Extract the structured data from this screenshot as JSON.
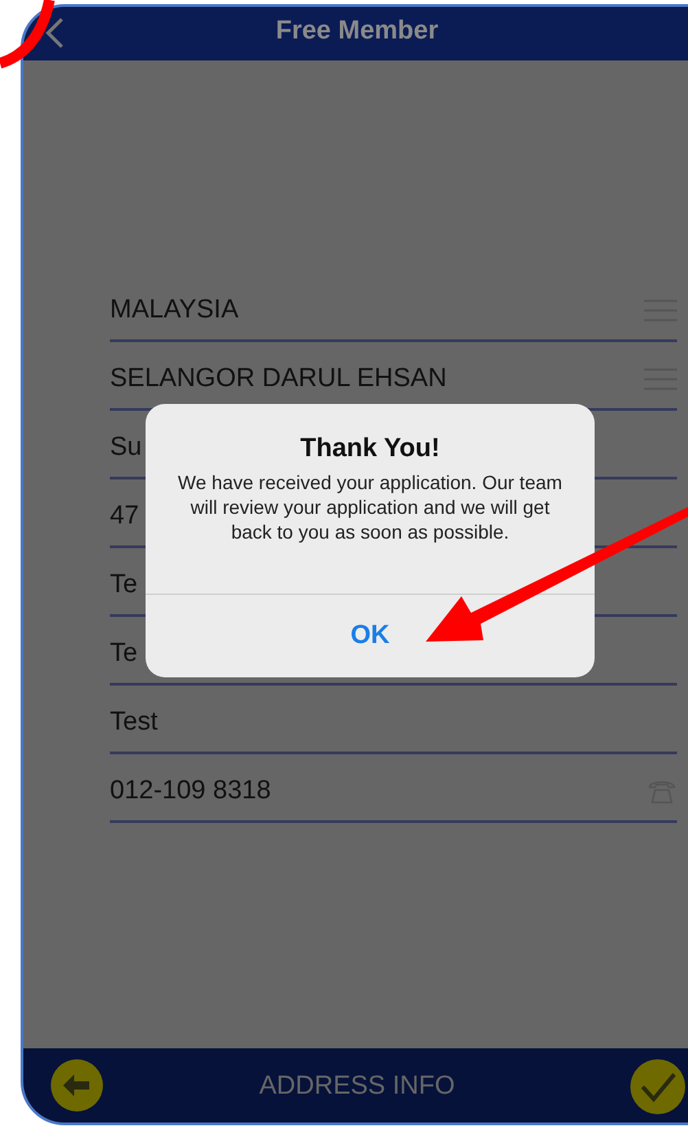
{
  "header": {
    "title": "Free Member"
  },
  "fields": [
    {
      "kind": "select",
      "value": "MALAYSIA"
    },
    {
      "kind": "select",
      "value": "SELANGOR DARUL EHSAN"
    },
    {
      "kind": "text",
      "value": "Su"
    },
    {
      "kind": "text",
      "value": "47"
    },
    {
      "kind": "text",
      "value": "Te"
    },
    {
      "kind": "text",
      "value": "Te"
    },
    {
      "kind": "text",
      "value": "Test"
    },
    {
      "kind": "phone",
      "value": "012-109 8318"
    }
  ],
  "dialog": {
    "title": "Thank You!",
    "message": "We have received your application. Our team will review your application and we will get back to you as soon as possible.",
    "button": "OK"
  },
  "footer": {
    "title": "ADDRESS INFO"
  }
}
